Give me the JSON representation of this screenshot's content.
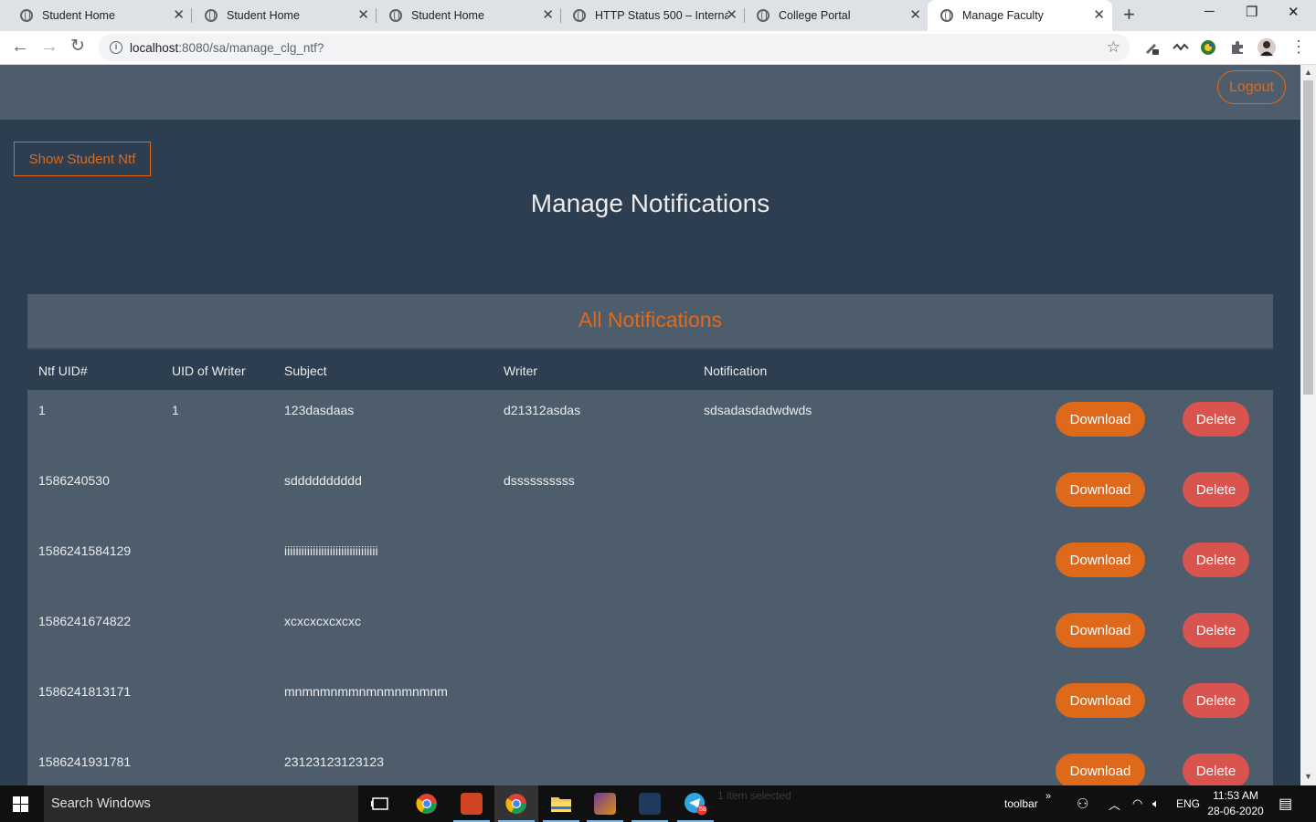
{
  "browser": {
    "tabs": [
      {
        "label": "Student Home",
        "active": false
      },
      {
        "label": "Student Home",
        "active": false
      },
      {
        "label": "Student Home",
        "active": false
      },
      {
        "label": "HTTP Status 500 – Interna",
        "active": false
      },
      {
        "label": "College Portal",
        "active": false
      },
      {
        "label": "Manage Faculty",
        "active": true
      }
    ],
    "url_host": "localhost",
    "url_path": ":8080/sa/manage_clg_ntf?",
    "new_tab": "+",
    "close_glyph": "✕",
    "window_controls": [
      "─",
      "❐",
      "✕"
    ]
  },
  "header": {
    "logout_label": "Logout"
  },
  "page": {
    "show_button_label": "Show Student Ntf",
    "title": "Manage Notifications"
  },
  "panel": {
    "title": "All Notifications",
    "columns": [
      "Ntf UID#",
      "UID of Writer",
      "Subject",
      "Writer",
      "Notification"
    ],
    "download_label": "Download",
    "delete_label": "Delete",
    "rows": [
      {
        "ntf_uid": "1",
        "writer_uid": "1",
        "subject": "123dasdaas",
        "writer": "d21312asdas",
        "notification": "sdsadasdadwdwds"
      },
      {
        "ntf_uid": "1586240530",
        "writer_uid": "",
        "subject": "sdddddddddd",
        "writer": "dssssssssss",
        "notification": ""
      },
      {
        "ntf_uid": "1586241584129",
        "writer_uid": "",
        "subject": "iiiiiiiiiiiiiiiiiiiiiiiiiiiiiiiii",
        "writer": "",
        "notification": ""
      },
      {
        "ntf_uid": "1586241674822",
        "writer_uid": "",
        "subject": "xcxcxcxcxcxc",
        "writer": "",
        "notification": ""
      },
      {
        "ntf_uid": "1586241813171",
        "writer_uid": "",
        "subject": "mnmnmnmmnmnmnmnmnm",
        "writer": "",
        "notification": ""
      },
      {
        "ntf_uid": "1586241931781",
        "writer_uid": "",
        "subject": "23123123123123",
        "writer": "",
        "notification": ""
      }
    ]
  },
  "taskbar": {
    "search_placeholder": "Search Windows",
    "toolbar_label": "toolbar",
    "language": "ENG",
    "time": "11:53 AM",
    "date": "28-06-2020",
    "ghost_text": "1 item selected",
    "telegram_badge": "58"
  },
  "colors": {
    "page_bg": "#2c3e50",
    "panel_bg": "#4e5d6c",
    "accent": "#df691a",
    "danger": "#d9534f",
    "text": "#ebebeb"
  }
}
